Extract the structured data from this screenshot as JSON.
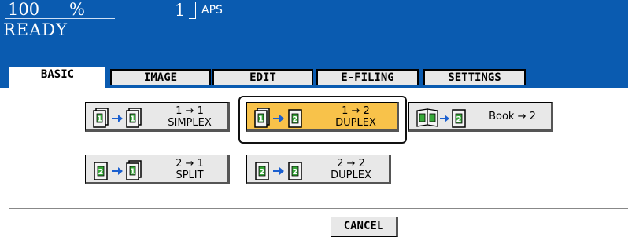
{
  "header": {
    "zoom_value": "100",
    "zoom_unit": "%",
    "copies": "1",
    "paper": "APS",
    "status": "READY"
  },
  "tabs": [
    {
      "label": "BASIC",
      "active": true
    },
    {
      "label": "IMAGE",
      "active": false
    },
    {
      "label": "EDIT",
      "active": false
    },
    {
      "label": "E-FILING",
      "active": false
    },
    {
      "label": "SETTINGS",
      "active": false
    }
  ],
  "modes": {
    "simplex": {
      "line1": "1 → 1",
      "line2": "SIMPLEX",
      "icon": "simplex-1-to-1-icon"
    },
    "duplex": {
      "line1": "1 → 2",
      "line2": "DUPLEX",
      "icon": "duplex-1-to-2-icon",
      "selected": true
    },
    "book": {
      "label": "Book → 2",
      "icon": "book-to-2-icon"
    },
    "split": {
      "line1": "2 → 1",
      "line2": "SPLIT",
      "icon": "split-2-to-1-icon"
    },
    "duplex22": {
      "line1": "2 → 2",
      "line2": "DUPLEX",
      "icon": "duplex-2-to-2-icon"
    }
  },
  "cancel_label": "CANCEL",
  "colors": {
    "header_bg": "#0a5bb0",
    "selected_bg": "#f8c24a",
    "button_bg": "#e8e8e8"
  }
}
